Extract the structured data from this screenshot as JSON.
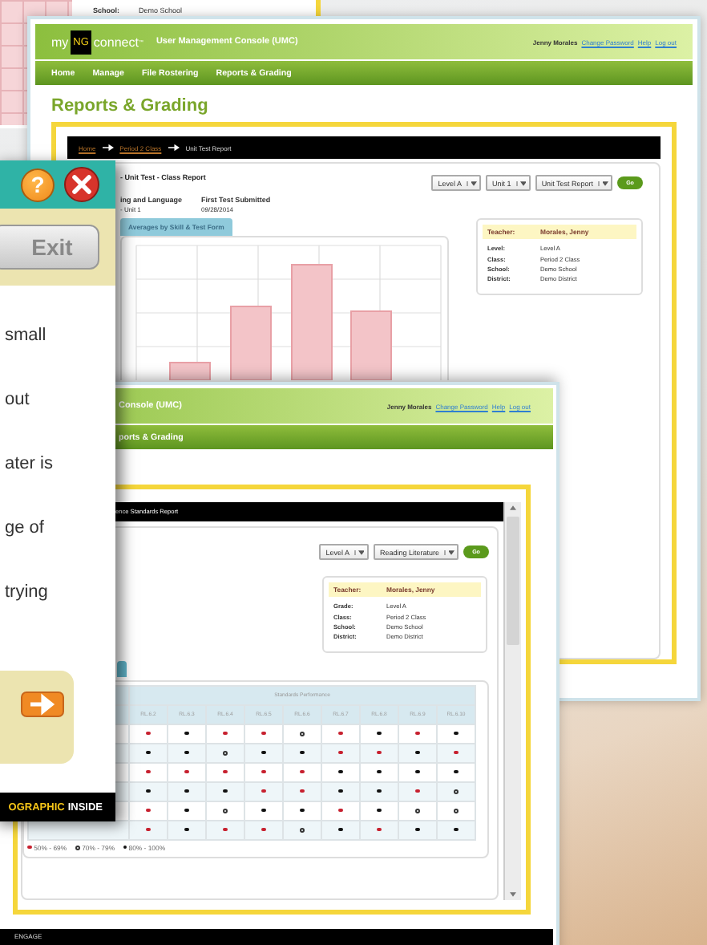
{
  "back_window": {
    "rows": [
      {
        "label": "School:",
        "value": "Demo School"
      }
    ]
  },
  "console_window": {
    "logo": {
      "my": "my",
      "ng": "NG",
      "connect": "connect",
      "tm": "™"
    },
    "title": "User Management Console (UMC)",
    "user": "Jenny Morales",
    "links": [
      "Change Password",
      "Help",
      "Log out"
    ],
    "nav": [
      {
        "label": "Home"
      },
      {
        "label": "Manage"
      },
      {
        "label": "File Rostering"
      },
      {
        "label": "Reports & Grading"
      }
    ],
    "heading": "Reports & Grading",
    "breadcrumb": [
      {
        "label": "Home",
        "link": true
      },
      {
        "label": "Period 2 Class",
        "link": true
      },
      {
        "label": "Unit Test Report",
        "link": false
      }
    ],
    "report_title": "- Unit Test - Class Report",
    "meta": [
      {
        "label": "ing and Language",
        "value": "- Unit 1"
      },
      {
        "label": "First Test Submitted",
        "value": "09/28/2014"
      }
    ],
    "selects": [
      "Level A",
      "Unit 1",
      "Unit Test Report"
    ],
    "go": "Go",
    "chart_tab": "Averages by Skill & Test Form",
    "teacher": {
      "label": "Teacher:",
      "name": "Morales, Jenny",
      "rows": [
        {
          "label": "Level:",
          "value": "Level A"
        },
        {
          "label": "Class:",
          "value": "Period 2 Class"
        },
        {
          "label": "School:",
          "value": "Demo School"
        },
        {
          "label": "District:",
          "value": "Demo District"
        }
      ]
    }
  },
  "popup": {
    "help": "?",
    "exit": "Exit",
    "lines": [
      "small",
      "out",
      "ater is",
      "ge of",
      "trying"
    ],
    "footer": [
      {
        "text": "OGRAPHIC",
        "kind": "accent"
      },
      {
        "text": "INSIDE",
        "kind": "plain"
      }
    ]
  },
  "standards_window": {
    "title": "Console (UMC)",
    "user": "Jenny Morales",
    "links": [
      "Change Password",
      "Help",
      "Log out"
    ],
    "nav": "ports & Grading",
    "bar": "ence Standards Report",
    "selects": [
      "Level A",
      "Reading Literature"
    ],
    "go": "Go",
    "teacher": {
      "label": "Teacher:",
      "name": "Morales, Jenny",
      "rows": [
        {
          "label": "Grade:",
          "value": "Level A"
        },
        {
          "label": "Class:",
          "value": "Period 2 Class"
        },
        {
          "label": "School:",
          "value": "Demo School"
        },
        {
          "label": "District:",
          "value": "Demo District"
        }
      ]
    },
    "table": {
      "group": "Standards Performance",
      "columns": [
        "RL.6.2",
        "RL.6.3",
        "RL.6.4",
        "RL.6.5",
        "RL.6.6",
        "RL.6.7",
        "RL.6.8",
        "RL.6.9",
        "RL.6.10"
      ],
      "rows": [
        {
          "cells": [
            {
              "kind": "low"
            },
            {
              "kind": "high"
            },
            {
              "kind": "low"
            },
            {
              "kind": "low"
            },
            {
              "kind": "mid"
            },
            {
              "kind": "low"
            },
            {
              "kind": "high"
            },
            {
              "kind": "low"
            },
            {
              "kind": "high"
            }
          ]
        },
        {
          "cells": [
            {
              "kind": "high"
            },
            {
              "kind": "high"
            },
            {
              "kind": "mid"
            },
            {
              "kind": "high"
            },
            {
              "kind": "high"
            },
            {
              "kind": "low"
            },
            {
              "kind": "low"
            },
            {
              "kind": "high"
            },
            {
              "kind": "low"
            }
          ]
        },
        {
          "cells": [
            {
              "kind": "low"
            },
            {
              "kind": "low"
            },
            {
              "kind": "low"
            },
            {
              "kind": "low"
            },
            {
              "kind": "low"
            },
            {
              "kind": "high"
            },
            {
              "kind": "high"
            },
            {
              "kind": "high"
            },
            {
              "kind": "high"
            }
          ]
        },
        {
          "cells": [
            {
              "kind": "high"
            },
            {
              "kind": "high"
            },
            {
              "kind": "high"
            },
            {
              "kind": "low"
            },
            {
              "kind": "low"
            },
            {
              "kind": "high"
            },
            {
              "kind": "high"
            },
            {
              "kind": "low"
            },
            {
              "kind": "mid"
            }
          ]
        },
        {
          "cells": [
            {
              "kind": "low"
            },
            {
              "kind": "high"
            },
            {
              "kind": "mid"
            },
            {
              "kind": "high"
            },
            {
              "kind": "high"
            },
            {
              "kind": "low"
            },
            {
              "kind": "high"
            },
            {
              "kind": "mid"
            },
            {
              "kind": "mid"
            }
          ]
        },
        {
          "cells": [
            {
              "kind": "low"
            },
            {
              "kind": "high"
            },
            {
              "kind": "low"
            },
            {
              "kind": "low"
            },
            {
              "kind": "mid"
            },
            {
              "kind": "high"
            },
            {
              "kind": "low"
            },
            {
              "kind": "high"
            },
            {
              "kind": "high"
            }
          ]
        }
      ]
    },
    "legend": [
      {
        "kind": "low",
        "label": "50% - 69%"
      },
      {
        "kind": "mid",
        "label": "70% - 79%"
      },
      {
        "kind": "high",
        "label": "80% - 100%"
      }
    ],
    "footer": "ENGAGE"
  }
}
